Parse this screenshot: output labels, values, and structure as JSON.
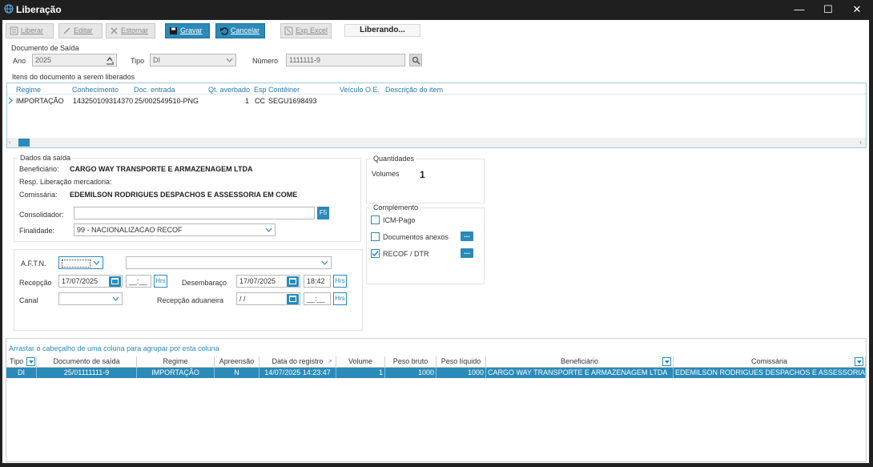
{
  "window": {
    "title": "Liberação"
  },
  "toolbar": {
    "liberar": "Liberar",
    "editar": "Editar",
    "estornar": "Estornar",
    "gravar": "Gravar",
    "cancelar": "Cancelar",
    "exp_excel": "Exp Excel",
    "status": "Liberando..."
  },
  "documento": {
    "group_title": "Documento de Saída",
    "ano_label": "Ano",
    "ano_value": "2025",
    "tipo_label": "Tipo",
    "tipo_value": "DI",
    "numero_label": "Número",
    "numero_value": "1111111-9"
  },
  "itens": {
    "group_title": "Itens do documento a serem liberados",
    "columns": [
      "Regime",
      "Conhecimento",
      "Doc. entrada",
      "Qt. averbado",
      "Esp",
      "Contêiner",
      "Veículo O.E.",
      "Descrição do item"
    ],
    "row": {
      "regime": "IMPORTAÇÃO",
      "conhecimento": "143250109314370",
      "doc_entrada": "25/002549510-PNG",
      "qt_averbado": "1",
      "esp": "CC",
      "conteiner": "SEGU1698493",
      "veiculo": "",
      "descricao": ""
    }
  },
  "dados_saida": {
    "group_title": "Dados da saída",
    "beneficiario_label": "Beneficiário:",
    "beneficiario_value": "CARGO WAY TRANSPORTE E ARMAZENAGEM LTDA",
    "resp_label": "Resp. Liberação mercadoria:",
    "comissaria_label": "Comissária:",
    "comissaria_value": "EDEMILSON RODRIGUES DESPACHOS E ASSESSORIA EM COME",
    "consolidador_label": "Consolidador:",
    "consolidador_value": "",
    "f5": "F5",
    "finalidade_label": "Finalidade:",
    "finalidade_value": "99 - NACIONALIZACAO RECOF"
  },
  "quantidades": {
    "group_title": "Quantidades",
    "volumes_label": "Volumes",
    "volumes_value": "1"
  },
  "complemento": {
    "group_title": "Complemento",
    "icm_label": "ICM-Pago",
    "icm_checked": false,
    "docs_label": "Documentos anexos",
    "docs_checked": false,
    "recof_label": "RECOF / DTR",
    "recof_checked": true,
    "more": "..."
  },
  "aftn": {
    "aftn_label": "A.F.T.N.",
    "aftn_value": "",
    "aftn_desc": "",
    "recepcao_label": "Recepção",
    "recepcao_date": "17/07/2025",
    "recepcao_time": "__:__",
    "hrs": "Hrs",
    "desembaraco_label": "Desembaraço",
    "desembaraco_date": "17/07/2025",
    "desembaraco_time": "18:42",
    "canal_label": "Canal",
    "canal_value": "",
    "recepcao_aduaneira_label": "Recepção aduaneira",
    "recepcao_aduaneira_date": " / /",
    "recepcao_aduaneira_time": "__:__"
  },
  "grid": {
    "group_hint": "Arrastar o cabeçalho de uma coluna para agrupar por esta coluna",
    "columns": [
      "Tipo",
      "Documento de saída",
      "Regime",
      "Apreensão",
      "Data do registro",
      "Volume",
      "Peso bruto",
      "Peso líquido",
      "Beneficiário",
      "Comissária"
    ],
    "row": {
      "tipo": "DI",
      "documento": "25/01111111-9",
      "regime": "IMPORTAÇÃO",
      "apreensao": "N",
      "data_registro": "14/07/2025 14:23:47",
      "volume": "1",
      "peso_bruto": "1000",
      "peso_liquido": "1000",
      "beneficiario": "CARGO WAY TRANSPORTE E ARMAZENAGEM LTDA",
      "comissaria": "EDEMILSON RODRIGUES DESPACHOS E ASSESSORIA E"
    }
  },
  "colors": {
    "accent": "#2a8ab8",
    "titlebar": "#1f1f1f"
  }
}
